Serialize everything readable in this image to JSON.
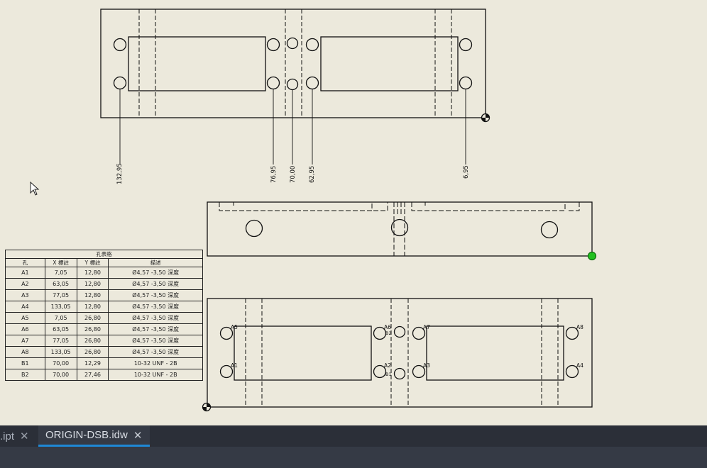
{
  "dimensions": {
    "top_view_labels": [
      "132,95",
      "76,95",
      "70,00",
      "62,95",
      "6,95"
    ]
  },
  "hole_labels": [
    "A1",
    "A2",
    "A3",
    "A4",
    "A5",
    "A6",
    "A7",
    "A8",
    "B1",
    "B2"
  ],
  "hole_table": {
    "caption": "孔表格",
    "headers": [
      "孔",
      "X 標註",
      "Y 標註",
      "描述"
    ],
    "rows": [
      [
        "A1",
        "7,05",
        "12,80",
        "Ø4,57 -3,50 深度"
      ],
      [
        "A2",
        "63,05",
        "12,80",
        "Ø4,57 -3,50 深度"
      ],
      [
        "A3",
        "77,05",
        "12,80",
        "Ø4,57 -3,50 深度"
      ],
      [
        "A4",
        "133,05",
        "12,80",
        "Ø4,57 -3,50 深度"
      ],
      [
        "A5",
        "7,05",
        "26,80",
        "Ø4,57 -3,50 深度"
      ],
      [
        "A6",
        "63,05",
        "26,80",
        "Ø4,57 -3,50 深度"
      ],
      [
        "A7",
        "77,05",
        "26,80",
        "Ø4,57 -3,50 深度"
      ],
      [
        "A8",
        "133,05",
        "26,80",
        "Ø4,57 -3,50 深度"
      ],
      [
        "B1",
        "70,00",
        "12,29",
        "10-32 UNF - 2B"
      ],
      [
        "B2",
        "70,00",
        "27,46",
        "10-32 UNF - 2B"
      ]
    ]
  },
  "tabs": [
    {
      "label": ".ipt",
      "active": false
    },
    {
      "label": "ORIGIN-DSB.idw",
      "active": true
    }
  ],
  "close_glyph": "✕",
  "colors": {
    "sheet_background": "#ece9dc",
    "line": "#111111",
    "tab_bar": "#2b2f38",
    "active_tab_underline": "#1e88d6",
    "selection_point": "#22c020"
  }
}
